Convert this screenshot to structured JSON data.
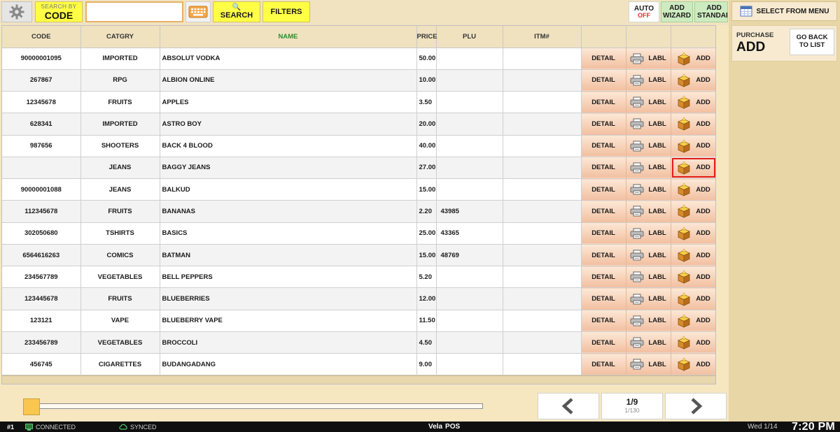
{
  "toolbar": {
    "searchby_small": "SEARCH BY",
    "searchby_big": "CODE",
    "search_value": "",
    "search_label": "SEARCH",
    "filters_label": "FILTERS",
    "auto_label": "AUTO",
    "auto_state": "OFF",
    "add_wizard_label": "ADD\nWIZARD",
    "add_standard_label": "ADD\nSTANDAR"
  },
  "right_panel": {
    "select_menu_label": "SELECT FROM MENU",
    "purchase_label": "PURCHASE",
    "purchase_mode": "ADD",
    "go_back_label": "GO BACK\nTO LIST"
  },
  "table": {
    "headers": {
      "code": "CODE",
      "category": "CATGRY",
      "name": "NAME",
      "price": "PRICE",
      "plu": "PLU",
      "item_no": "ITM#"
    },
    "actions": {
      "detail": "DETAIL",
      "label": "LABL",
      "add": "ADD"
    },
    "rows": [
      {
        "code": "90000001095",
        "category": "IMPORTED",
        "name": "ABSOLUT VODKA",
        "price": "50.00",
        "plu": "",
        "item_no": ""
      },
      {
        "code": "267867",
        "category": "RPG",
        "name": "ALBION ONLINE",
        "price": "10.00",
        "plu": "",
        "item_no": ""
      },
      {
        "code": "12345678",
        "category": "FRUITS",
        "name": "APPLES",
        "price": "3.50",
        "plu": "",
        "item_no": ""
      },
      {
        "code": "628341",
        "category": "IMPORTED",
        "name": "ASTRO BOY",
        "price": "20.00",
        "plu": "",
        "item_no": ""
      },
      {
        "code": "987656",
        "category": "SHOOTERS",
        "name": "BACK 4 BLOOD",
        "price": "40.00",
        "plu": "",
        "item_no": ""
      },
      {
        "code": "",
        "category": "JEANS",
        "name": "BAGGY JEANS",
        "price": "27.00",
        "plu": "",
        "item_no": ""
      },
      {
        "code": "90000001088",
        "category": "JEANS",
        "name": "BALKUD",
        "price": "15.00",
        "plu": "",
        "item_no": ""
      },
      {
        "code": "112345678",
        "category": "FRUITS",
        "name": "BANANAS",
        "price": "2.20",
        "plu": "43985",
        "item_no": ""
      },
      {
        "code": "302050680",
        "category": "TSHIRTS",
        "name": "BASICS",
        "price": "25.00",
        "plu": "43365",
        "item_no": ""
      },
      {
        "code": "6564616263",
        "category": "COMICS",
        "name": "BATMAN",
        "price": "15.00",
        "plu": "48769",
        "item_no": ""
      },
      {
        "code": "234567789",
        "category": "VEGETABLES",
        "name": "BELL PEPPERS",
        "price": "5.20",
        "plu": "",
        "item_no": ""
      },
      {
        "code": "123445678",
        "category": "FRUITS",
        "name": "BLUEBERRIES",
        "price": "12.00",
        "plu": "",
        "item_no": ""
      },
      {
        "code": "123121",
        "category": "VAPE",
        "name": "BLUEBERRY VAPE",
        "price": "11.50",
        "plu": "",
        "item_no": ""
      },
      {
        "code": "233456789",
        "category": "VEGETABLES",
        "name": "BROCCOLI",
        "price": "4.50",
        "plu": "",
        "item_no": ""
      },
      {
        "code": "456745",
        "category": "CIGARETTES",
        "name": "BUDANGADANG",
        "price": "9.00",
        "plu": "",
        "item_no": ""
      }
    ],
    "highlighted_add_row": 5
  },
  "pagination": {
    "page": "1/9",
    "total": "1/130",
    "slider_fraction": 0.0
  },
  "statusbar": {
    "station": "#1",
    "connection": "CONNECTED",
    "sync": "SYNCED",
    "brand_prefix": "Vela",
    "brand_suffix": "POS",
    "date": "Wed 1/14",
    "time": "7:20 PM"
  },
  "colors": {
    "toolbar_yellow": "#ffff45",
    "add_green": "#cdebc0",
    "action_orange": "#f2bfa0",
    "highlight_red": "#e21d1d",
    "name_header_green": "#2e8b2e",
    "auto_off_red": "#e52b2b"
  },
  "icons": {
    "settings": "gear-icon",
    "keyboard": "keyboard-icon",
    "search": "magnifier-icon",
    "menu": "calendar-icon",
    "label": "printer-icon",
    "add": "box-icon",
    "prev": "chevron-left-icon",
    "next": "chevron-right-icon"
  }
}
